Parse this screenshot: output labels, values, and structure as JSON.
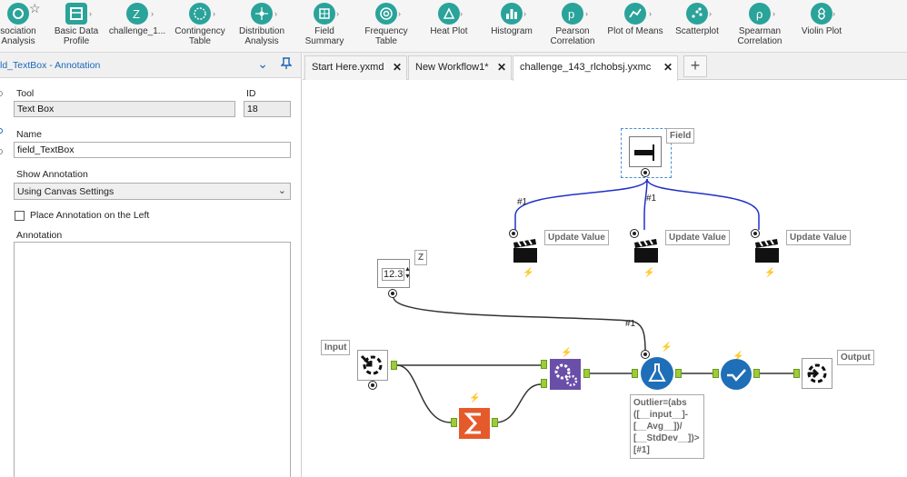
{
  "palette": {
    "tools": [
      {
        "label": "sociation\nAnalysis",
        "icon": "association-analysis-icon"
      },
      {
        "label": "Basic Data\nProfile",
        "icon": "basic-data-profile-icon"
      },
      {
        "label": "challenge_1...",
        "icon": "challenge-macro-icon"
      },
      {
        "label": "Contingency\nTable",
        "icon": "contingency-table-icon"
      },
      {
        "label": "Distribution\nAnalysis",
        "icon": "distribution-analysis-icon"
      },
      {
        "label": "Field\nSummary",
        "icon": "field-summary-icon"
      },
      {
        "label": "Frequency\nTable",
        "icon": "frequency-table-icon"
      },
      {
        "label": "Heat Plot",
        "icon": "heat-plot-icon"
      },
      {
        "label": "Histogram",
        "icon": "histogram-icon"
      },
      {
        "label": "Pearson\nCorrelation",
        "icon": "pearson-correlation-icon"
      },
      {
        "label": "Plot of Means",
        "icon": "plot-of-means-icon"
      },
      {
        "label": "Scatterplot",
        "icon": "scatterplot-icon"
      },
      {
        "label": "Spearman\nCorrelation",
        "icon": "spearman-correlation-icon"
      },
      {
        "label": "Violin Plot",
        "icon": "violin-plot-icon"
      }
    ],
    "tool_color": "#2aa39a"
  },
  "panel": {
    "title": "ld_TextBox - Annotation",
    "tool_label": "Tool",
    "tool_value": "Text Box",
    "id_label": "ID",
    "id_value": "18",
    "name_label": "Name",
    "name_value": "field_TextBox",
    "show_annotation_label": "Show Annotation",
    "show_annotation_value": "Using Canvas Settings",
    "place_left_label": "Place Annotation on the Left",
    "place_left_checked": false,
    "annotation_label": "Annotation",
    "annotation_value": ""
  },
  "tabs": [
    {
      "label": "Start Here.yxmd",
      "active": false
    },
    {
      "label": "New Workflow1*",
      "active": false
    },
    {
      "label": "challenge_143_rlchobsj.yxmc",
      "active": true
    }
  ],
  "canvas": {
    "annotations": {
      "field": "Field",
      "z": "Z",
      "input": "Input",
      "output": "Output",
      "update_value": "Update Value",
      "formula": "Outlier=(abs\n([__input__]-\n[__Avg__])/\n[__StdDev__])>\n[#1]"
    },
    "numeric_value": "12.3",
    "connection_label": "#1",
    "wire_blue": "#2030c8",
    "wire_dark": "#333333"
  }
}
